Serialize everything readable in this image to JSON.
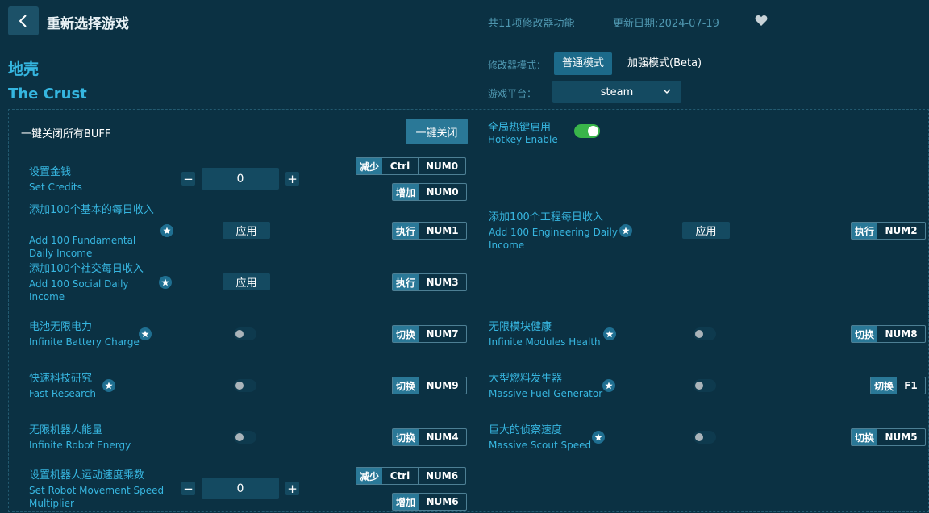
{
  "header": {
    "title": "重新选择游戏",
    "feature_count": "共11项修改器功能",
    "update_date": "更新日期:2024-07-19"
  },
  "game": {
    "name_cn": "地壳",
    "name_en": "The Crust"
  },
  "mode": {
    "label": "修改器模式：",
    "normal": "普通模式",
    "beta": "加强模式(Beta)"
  },
  "platform": {
    "label": "游戏平台：",
    "value": "steam"
  },
  "kill_all": {
    "label": "一键关闭所有BUFF",
    "button": "一键关闭"
  },
  "hotkey": {
    "cn": "全局热键启用",
    "en": "Hotkey Enable",
    "enabled": true
  },
  "labels": {
    "decrease": "减少",
    "increase": "增加",
    "execute": "执行",
    "toggle": "切换",
    "apply": "应用"
  },
  "features": [
    {
      "cn": "设置金钱",
      "en": "Set Credits",
      "value": "0",
      "dec_keys": [
        "Ctrl",
        "NUM0"
      ],
      "inc_keys": [
        "NUM0"
      ]
    },
    {
      "cn": "添加100个基本的每日收入",
      "en": "Add 100 Fundamental Daily Income",
      "keys": [
        "NUM1"
      ]
    },
    {
      "cn": "添加100个工程每日收入",
      "en": "Add 100 Engineering Daily Income",
      "keys": [
        "NUM2"
      ]
    },
    {
      "cn": "添加100个社交每日收入",
      "en": "Add 100 Social Daily Income",
      "keys": [
        "NUM3"
      ]
    },
    {
      "cn": "电池无限电力",
      "en": "Infinite Battery Charge",
      "keys": [
        "NUM7"
      ]
    },
    {
      "cn": "无限模块健康",
      "en": "Infinite Modules Health",
      "keys": [
        "NUM8"
      ]
    },
    {
      "cn": "快速科技研究",
      "en": "Fast Research",
      "keys": [
        "NUM9"
      ]
    },
    {
      "cn": "大型燃料发生器",
      "en": "Massive Fuel Generator",
      "keys": [
        "F1"
      ]
    },
    {
      "cn": "无限机器人能量",
      "en": "Infinite Robot Energy",
      "keys": [
        "NUM4"
      ]
    },
    {
      "cn": "巨大的侦察速度",
      "en": "Massive Scout Speed",
      "keys": [
        "NUM5"
      ]
    },
    {
      "cn": "设置机器人运动速度乘数",
      "en": "Set Robot Movement Speed Multiplier",
      "value": "0",
      "dec_keys": [
        "Ctrl",
        "NUM6"
      ],
      "inc_keys": [
        "NUM6"
      ]
    }
  ],
  "colors": {
    "background": "#0b3143",
    "accent": "#35b6e0",
    "toggle_on": "#39b54a"
  }
}
